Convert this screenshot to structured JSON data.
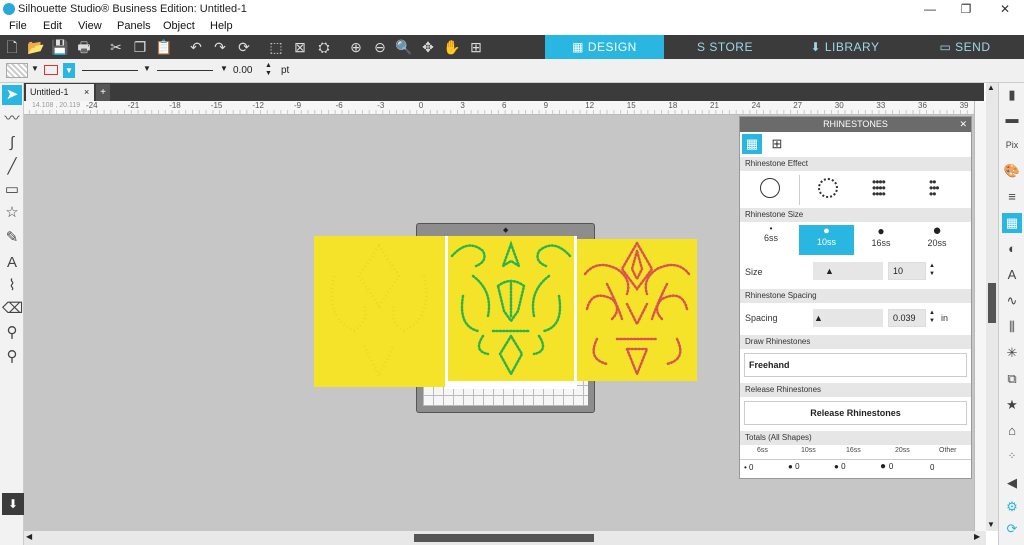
{
  "window": {
    "title": "Silhouette Studio® Business Edition: Untitled-1",
    "min": "—",
    "max": "❐",
    "close": "✕"
  },
  "menu": [
    "File",
    "Edit",
    "View",
    "Panels",
    "Object",
    "Help"
  ],
  "tabs": {
    "design": "DESIGN",
    "store": "STORE",
    "library": "LIBRARY",
    "send": "SEND"
  },
  "stylebar": {
    "value": "0.00",
    "unit": "pt"
  },
  "doc": {
    "tab": "Untitled-1",
    "close": "×",
    "add": "+",
    "coords": "14.108 , 20.119"
  },
  "ruler": [
    "-24",
    "-21",
    "-18",
    "-15",
    "-12",
    "-9",
    "-6",
    "-3",
    "0",
    "3",
    "6",
    "9",
    "12",
    "15",
    "18",
    "21",
    "24",
    "27",
    "30",
    "33",
    "36",
    "39"
  ],
  "panel": {
    "title": "RHINESTONES",
    "close": "✕",
    "effect_label": "Rhinestone Effect",
    "size_label": "Rhinestone Size",
    "sizes": [
      "6ss",
      "10ss",
      "16ss",
      "20ss"
    ],
    "size_field_label": "Size",
    "size_value": "10",
    "spacing_label": "Rhinestone Spacing",
    "spacing_field_label": "Spacing",
    "spacing_value": "0.039",
    "spacing_unit": "in",
    "draw_label": "Draw Rhinestones",
    "freehand": "Freehand",
    "release_label": "Release Rhinestones",
    "release_button": "Release Rhinestones",
    "totals_label": "Totals (All Shapes)",
    "totals_heads": [
      "6ss",
      "10ss",
      "16ss",
      "20ss",
      "Other"
    ],
    "totals_vals": [
      "0",
      "0",
      "0",
      "0",
      "0"
    ]
  },
  "colors": {
    "accent": "#29b6e0",
    "yellow": "#f5e32a",
    "green": "#2db34a",
    "red": "#d9534f"
  }
}
